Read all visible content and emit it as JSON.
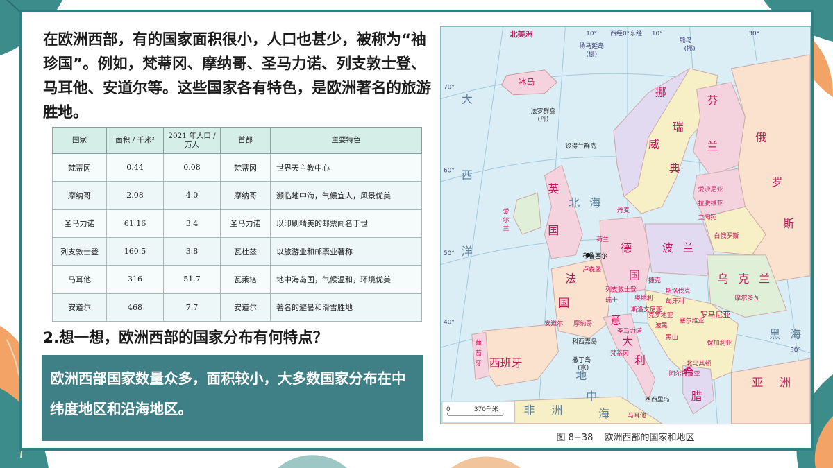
{
  "intro": {
    "text": "在欧洲西部，有的国家面积很小，人口也甚少，被称为“袖珍国”。例如，梵蒂冈、摩纳哥、圣马力诺、列支敦士登、马耳他、安道尔等。这些国家各有特色，是欧洲著名的旅游胜地。"
  },
  "table": {
    "headers": [
      "国家",
      "面积 / 千米²",
      "2021 年人口 / 万人",
      "首都",
      "主要特色"
    ],
    "rows": [
      [
        "梵蒂冈",
        "0.44",
        "0.08",
        "梵蒂冈",
        "世界天主教中心"
      ],
      [
        "摩纳哥",
        "2.08",
        "4.0",
        "摩纳哥",
        "濒临地中海，气候宜人，风景优美"
      ],
      [
        "圣马力诺",
        "61.16",
        "3.4",
        "圣马力诺",
        "以印刷精美的邮票闻名于世"
      ],
      [
        "列支敦士登",
        "160.5",
        "3.8",
        "瓦杜兹",
        "以旅游业和邮票业著称"
      ],
      [
        "马耳他",
        "316",
        "51.7",
        "瓦莱塔",
        "地中海岛国，气候温和，环境优美"
      ],
      [
        "安道尔",
        "468",
        "7.7",
        "安道尔",
        "著名的避暑和滑雪胜地"
      ]
    ]
  },
  "question": "2.想一想，欧洲西部的国家分布有何特点？",
  "answer": "欧洲西部国家数量众多，面积较小，大多数国家分布在中纬度地区和沿海地区。",
  "map": {
    "caption_num": "图 8−38",
    "caption_title": "欧洲西部的国家和地区",
    "scale_zero": "0",
    "scale_label": "370千米",
    "top_labels": [
      "北美洲",
      "10°",
      "西经0°东经",
      "10°",
      "熊岛",
      "(挪)",
      "扬马延岛",
      "(挪)",
      "30°"
    ],
    "regions": {
      "iceland": "冰岛",
      "faroe": "法罗群岛",
      "faroe_owner": "(丹)",
      "shetland": "设得兰群岛",
      "ocean": [
        "大",
        "西",
        "洋"
      ],
      "norway": [
        "挪",
        "威"
      ],
      "sweden": [
        "瑞",
        "典"
      ],
      "finland": [
        "芬",
        "兰"
      ],
      "russia": [
        "俄",
        "罗",
        "斯"
      ],
      "estonia": "爱沙尼亚",
      "latvia": "拉脱维亚",
      "lithuania": "立陶宛",
      "belarus": "白俄罗斯",
      "ireland": [
        "爱",
        "尔",
        "兰"
      ],
      "uk": [
        "英",
        "国"
      ],
      "north_sea": [
        "北",
        "海"
      ],
      "denmark": "丹麦",
      "netherlands": "荷兰",
      "germany": [
        "德",
        "国"
      ],
      "poland": [
        "波",
        "兰"
      ],
      "brussels": "布鲁塞尔",
      "luxembourg": "卢森堡",
      "czech": "捷克",
      "slovakia": "斯洛伐克",
      "ukraine": [
        "乌",
        "克",
        "兰"
      ],
      "france": [
        "法",
        "国"
      ],
      "liechtenstein": "列支敦士登",
      "switzerland": "瑞士",
      "austria": "奥地利",
      "hungary": "匈牙利",
      "moldova": "摩尔多瓦",
      "slovenia": "斯洛文尼亚",
      "croatia": "克罗地亚",
      "bosnia": "波黑",
      "serbia": "塞尔维亚",
      "montenegro": "黑山",
      "romania": "罗马尼亚",
      "bulgaria": "保加利亚",
      "black_sea": [
        "黑",
        "海"
      ],
      "portugal": [
        "葡",
        "萄",
        "牙"
      ],
      "spain": "西班牙",
      "andorra": "安道尔",
      "monaco": "摩纳哥",
      "san_marino": "圣马力诺",
      "vatican": "梵蒂冈",
      "italy": [
        "意",
        "大",
        "利"
      ],
      "corsica": "科西嘉岛",
      "sardinia": "撒丁岛",
      "sardinia_owner": "(意)",
      "greece": [
        "希",
        "腊"
      ],
      "albania": "阿尔巴尼亚",
      "north_macedonia": "北马其顿",
      "sicily": "西西里岛",
      "malta": "马耳他",
      "mediterranean": [
        "地",
        "中",
        "海"
      ],
      "africa": [
        "非",
        "洲"
      ],
      "asia": [
        "亚",
        "洲"
      ],
      "lat_labels": [
        "70°",
        "60°",
        "50°",
        "40°",
        "30°"
      ]
    }
  },
  "colors": {
    "frame": "#2f7f83",
    "answer_bg": "#3f7f86",
    "table_header": "#d6eee8",
    "sea": "#dbeef6",
    "country_pink": "#f4d3df",
    "country_yellow": "#f7efc5",
    "country_purple": "#e2daf0",
    "country_green": "#e0f0d8",
    "country_peach": "#fbe2cf"
  }
}
